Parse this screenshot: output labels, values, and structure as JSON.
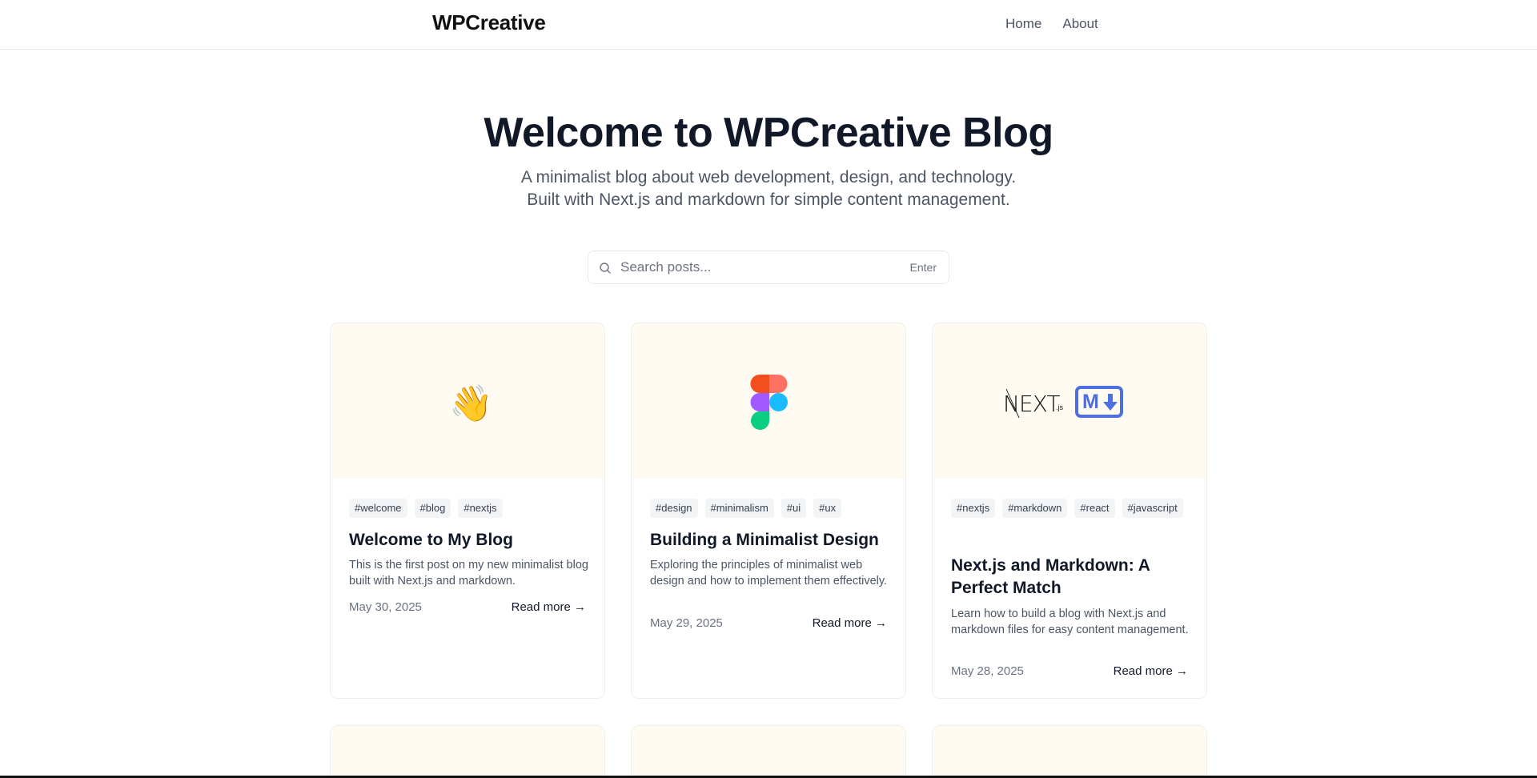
{
  "header": {
    "brand": "WPCreative",
    "nav": [
      "Home",
      "About"
    ]
  },
  "hero": {
    "title": "Welcome to WPCreative Blog",
    "subtitle_line1": "A minimalist blog about web development, design, and technology.",
    "subtitle_line2": "Built with Next.js and markdown for simple content management."
  },
  "search": {
    "placeholder": "Search posts...",
    "hint": "Enter",
    "icon": "search-icon"
  },
  "posts": [
    {
      "thumb_icon": "waving-hand-icon",
      "thumb_emoji": "👋",
      "tags": [
        "#welcome",
        "#blog",
        "#nextjs"
      ],
      "title": "Welcome to My Blog",
      "excerpt": "This is the first post on my new minimalist blog built with Next.js and markdown.",
      "date": "May 30, 2025",
      "read_more": "Read more →"
    },
    {
      "thumb_icon": "figma-logo-icon",
      "tags": [
        "#design",
        "#minimalism",
        "#ui",
        "#ux"
      ],
      "title": "Building a Minimalist Design",
      "excerpt": "Exploring the principles of minimalist web design and how to implement them effectively.",
      "date": "May 29, 2025",
      "read_more": "Read more →"
    },
    {
      "thumb_icon": "nextjs-markdown-logo-icon",
      "thumb_text": "NEXT",
      "thumb_text_sub": ".js",
      "thumb_md": "M",
      "tags": [
        "#nextjs",
        "#markdown",
        "#react",
        "#javascript"
      ],
      "title": "Next.js and Markdown: A Perfect Match",
      "excerpt": "Learn how to build a blog with Next.js and markdown files for easy content management.",
      "date": "May 28, 2025",
      "read_more": "Read more →"
    }
  ],
  "colors": {
    "thumb_bg": "#fffbf2",
    "text_primary": "#111827",
    "text_muted": "#4b5563",
    "tag_bg": "#f3f4f6",
    "markdown_blue": "#4f6fe0"
  }
}
